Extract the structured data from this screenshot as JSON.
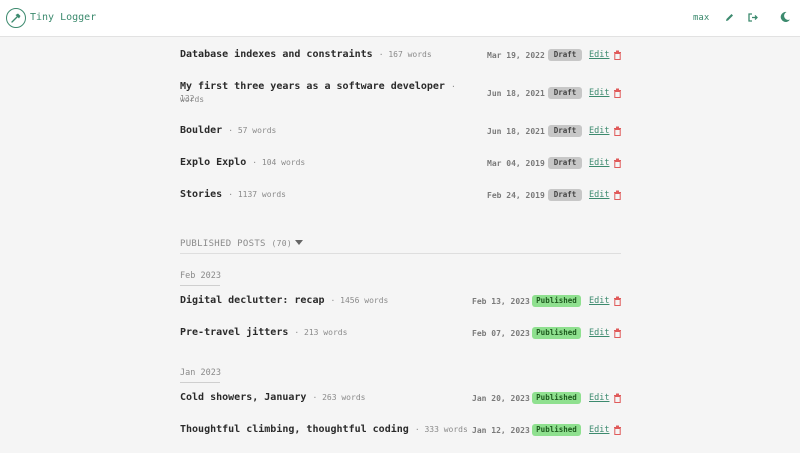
{
  "app": {
    "title": "Tiny Logger"
  },
  "nav": {
    "user": "max",
    "icons": [
      "pencil-icon",
      "logout-icon",
      "moon-icon"
    ]
  },
  "colors": {
    "accent": "#3c8a6e",
    "draft_badge": "#c7c7c7",
    "published_badge": "#8fe08f",
    "delete": "#e05a5a"
  },
  "drafts": [
    {
      "title": "Database indexes and constraints",
      "words": "· 167 words",
      "date": "Mar 19, 2022",
      "status": "Draft",
      "edit": "Edit"
    },
    {
      "title": "My first three years as a software developer",
      "words": "· 132",
      "words2": "words",
      "date": "Jun 18, 2021",
      "status": "Draft",
      "edit": "Edit"
    },
    {
      "title": "Boulder",
      "words": "· 57 words",
      "date": "Jun 18, 2021",
      "status": "Draft",
      "edit": "Edit"
    },
    {
      "title": "Explo Explo",
      "words": "· 104 words",
      "date": "Mar 04, 2019",
      "status": "Draft",
      "edit": "Edit"
    },
    {
      "title": "Stories",
      "words": "· 1137 words",
      "date": "Feb 24, 2019",
      "status": "Draft",
      "edit": "Edit"
    }
  ],
  "published": {
    "heading": "PUBLISHED POSTS",
    "count": "(70)",
    "months": [
      {
        "label": "Feb 2023",
        "posts": [
          {
            "title": "Digital declutter: recap",
            "words": "· 1456 words",
            "date": "Feb 13, 2023",
            "status": "Published",
            "edit": "Edit"
          },
          {
            "title": "Pre-travel jitters",
            "words": "· 213 words",
            "date": "Feb 07, 2023",
            "status": "Published",
            "edit": "Edit"
          }
        ]
      },
      {
        "label": "Jan 2023",
        "posts": [
          {
            "title": "Cold showers, January",
            "words": "· 263 words",
            "date": "Jan 20, 2023",
            "status": "Published",
            "edit": "Edit"
          },
          {
            "title": "Thoughtful climbing, thoughtful coding",
            "words": "· 333 words",
            "date": "Jan 12, 2023",
            "status": "Published",
            "edit": "Edit"
          }
        ]
      }
    ]
  }
}
